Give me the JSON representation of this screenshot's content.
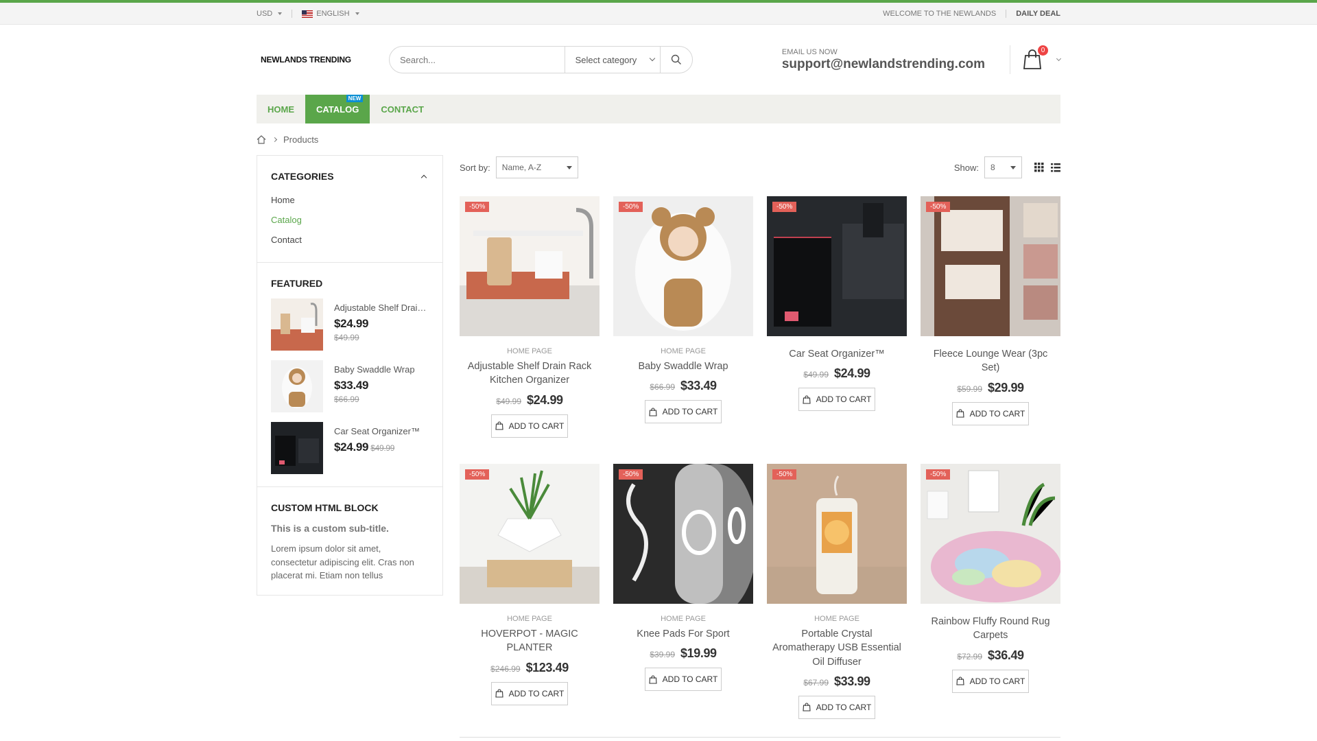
{
  "topbar": {
    "currency": "USD",
    "language": "ENGLISH",
    "welcome": "WELCOME TO THE NEWLANDS",
    "daily_deal": "DAILY DEAL"
  },
  "header": {
    "logo_text": "NEWLANDS TRENDING",
    "search_placeholder": "Search...",
    "category_select": "Select category",
    "email_label": "EMAIL US NOW",
    "email_value": "support@newlandstrending.com",
    "cart_count": "0"
  },
  "nav": {
    "items": [
      {
        "label": "HOME"
      },
      {
        "label": "CATALOG",
        "badge": "NEW"
      },
      {
        "label": "CONTACT"
      }
    ]
  },
  "breadcrumb": {
    "current": "Products"
  },
  "sidebar": {
    "categories_title": "CATEGORIES",
    "categories": [
      "Home",
      "Catalog",
      "Contact"
    ],
    "featured_title": "FEATURED",
    "featured": [
      {
        "name": "Adjustable Shelf Drain Rack Kitchen Organizer",
        "price": "$24.99",
        "old": "$49.99"
      },
      {
        "name": "Baby Swaddle Wrap",
        "price": "$33.49",
        "old": "$66.99"
      },
      {
        "name": "Car Seat Organizer™",
        "price": "$24.99",
        "old": "$49.99"
      }
    ],
    "custom_title": "CUSTOM HTML BLOCK",
    "custom_subtitle": "This is a custom sub-title.",
    "custom_body": "Lorem ipsum dolor sit amet, consectetur adipiscing elit. Cras non placerat mi. Etiam non tellus"
  },
  "toolbar": {
    "sort_label": "Sort by:",
    "sort_value": "Name, A-Z",
    "show_label": "Show:",
    "show_value": "8"
  },
  "products": [
    {
      "category": "HOME PAGE",
      "name": "Adjustable Shelf Drain Rack Kitchen Organizer",
      "old": "$49.99",
      "price": "$24.99",
      "discount": "-50%",
      "atc": "ADD TO CART"
    },
    {
      "category": "HOME PAGE",
      "name": "Baby Swaddle Wrap",
      "old": "$66.99",
      "price": "$33.49",
      "discount": "-50%",
      "atc": "ADD TO CART"
    },
    {
      "category": "",
      "name": "Car Seat Organizer™",
      "old": "$49.99",
      "price": "$24.99",
      "discount": "-50%",
      "atc": "ADD TO CART"
    },
    {
      "category": "",
      "name": "Fleece Lounge Wear (3pc Set)",
      "old": "$59.99",
      "price": "$29.99",
      "discount": "-50%",
      "atc": "ADD TO CART"
    },
    {
      "category": "HOME PAGE",
      "name": "HOVERPOT - MAGIC PLANTER",
      "old": "$246.99",
      "price": "$123.49",
      "discount": "-50%",
      "atc": "ADD TO CART"
    },
    {
      "category": "HOME PAGE",
      "name": "Knee Pads For Sport",
      "old": "$39.99",
      "price": "$19.99",
      "discount": "-50%",
      "atc": "ADD TO CART"
    },
    {
      "category": "HOME PAGE",
      "name": "Portable Crystal Aromatherapy USB Essential Oil Diffuser",
      "old": "$67.99",
      "price": "$33.99",
      "discount": "-50%",
      "atc": "ADD TO CART"
    },
    {
      "category": "",
      "name": "Rainbow Fluffy Round Rug Carpets",
      "old": "$72.99",
      "price": "$36.49",
      "discount": "-50%",
      "atc": "ADD TO CART"
    }
  ],
  "colors": {
    "accent": "#5aa64a",
    "badge_new": "#0b8fd3",
    "discount": "#e36159",
    "cart_badge": "#e44444"
  }
}
